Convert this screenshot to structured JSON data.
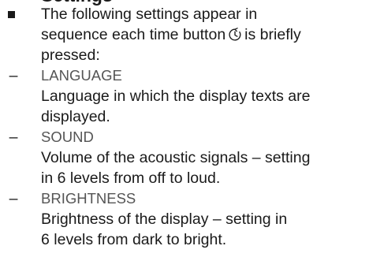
{
  "heading_fragment": "Settings",
  "intro": {
    "line1": "The following settings appear in",
    "line2_before": "sequence each time button",
    "line2_icon": "timer-clock-icon",
    "line2_after": "is briefly",
    "line3": "pressed:"
  },
  "dash_marker": "–",
  "settings": [
    {
      "name": "LANGUAGE",
      "desc_line1": "Language in which the display texts are",
      "desc_line2": "displayed."
    },
    {
      "name": "SOUND",
      "desc_line1": "Volume of the acoustic signals – setting",
      "desc_line2": "in 6 levels from off to loud."
    },
    {
      "name": "BRIGHTNESS",
      "desc_line1": "Brightness of the display – setting in",
      "desc_line2": "6 levels from dark to bright."
    }
  ]
}
